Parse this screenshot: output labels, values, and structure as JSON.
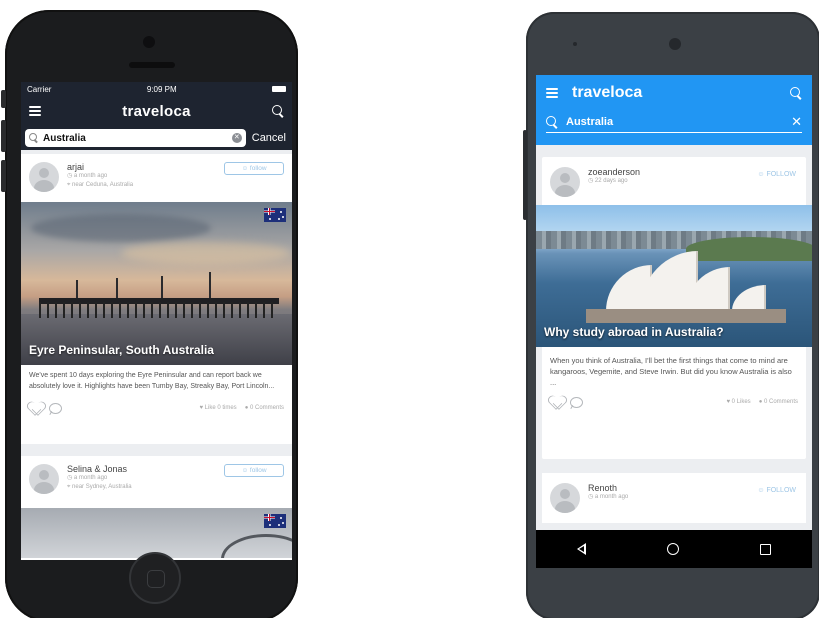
{
  "iphone": {
    "status": {
      "carrier": "Carrier",
      "time": "9:09 PM"
    },
    "nav": {
      "logo": "traveloca"
    },
    "search": {
      "value": "Australia",
      "cancel": "Cancel"
    },
    "posts": [
      {
        "user": "arjai",
        "time": "a month ago",
        "location": "near Ceduna, Australia",
        "follow": "follow",
        "title": "Eyre Peninsular, South Australia",
        "text": "We've spent 10 days exploring the Eyre Peninsular and can report back we absolutely love it. Highlights have been Tumby Bay, Streaky Bay, Port Lincoln...",
        "likes": "Like 0 times",
        "comments": "0 Comments"
      },
      {
        "user": "Selina & Jonas",
        "time": "a month ago",
        "location": "near Sydney, Australia",
        "follow": "follow"
      }
    ]
  },
  "android": {
    "nav": {
      "logo": "traveloca"
    },
    "search": {
      "value": "Australia"
    },
    "posts": [
      {
        "user": "zoeanderson",
        "time": "22 days ago",
        "follow": "FOLLOW",
        "title": "Why study abroad in Australia?",
        "text": "When you think of Australia, I'll bet the first things that come to mind are kangaroos, Vegemite, and Steve Irwin. But did you know Australia is also ...",
        "likes": "0 Likes",
        "comments": "0 Comments"
      },
      {
        "user": "Renoth",
        "time": "a month ago",
        "follow": "FOLLOW"
      }
    ]
  },
  "colors": {
    "ios_nav": "#1e2430",
    "android_accent": "#2196f3",
    "follow": "#9ec6e6"
  }
}
